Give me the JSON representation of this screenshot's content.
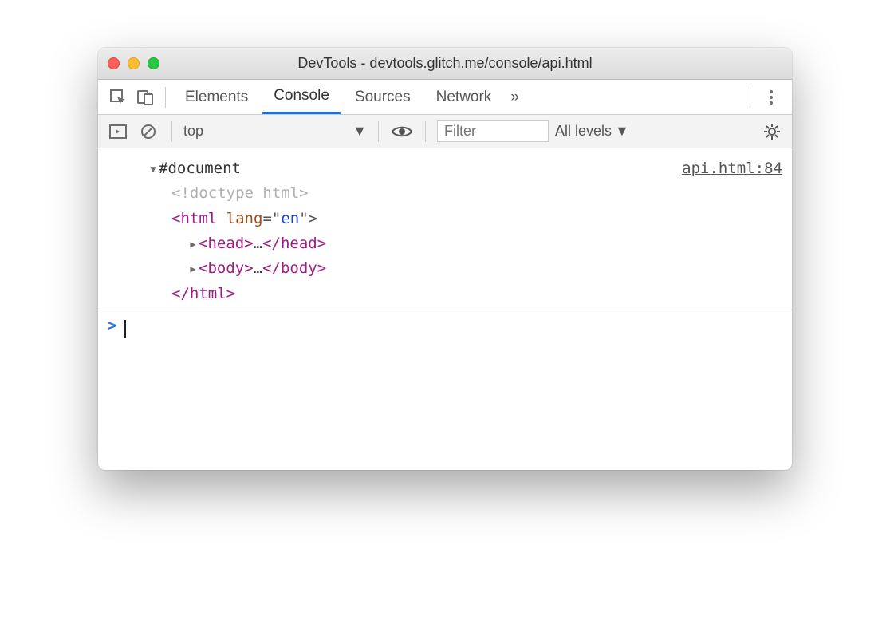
{
  "window": {
    "title": "DevTools - devtools.glitch.me/console/api.html"
  },
  "tabs": {
    "elements": "Elements",
    "console": "Console",
    "sources": "Sources",
    "network": "Network",
    "overflow": "»"
  },
  "filter": {
    "context": "top",
    "placeholder": "Filter",
    "levels": "All levels"
  },
  "console": {
    "source_link": "api.html:84",
    "doc_label": "#document",
    "doctype": "<!doctype html>",
    "html_open_pre": "<",
    "html_tag": "html",
    "html_attr_name": "lang",
    "html_attr_eq": "=\"",
    "html_attr_val": "en",
    "html_attr_close": "\">",
    "head_open": "<head>",
    "head_close": "</head>",
    "body_open": "<body>",
    "body_close": "</body>",
    "ellipsis": "…",
    "html_close": "</html>",
    "prompt": ">"
  }
}
